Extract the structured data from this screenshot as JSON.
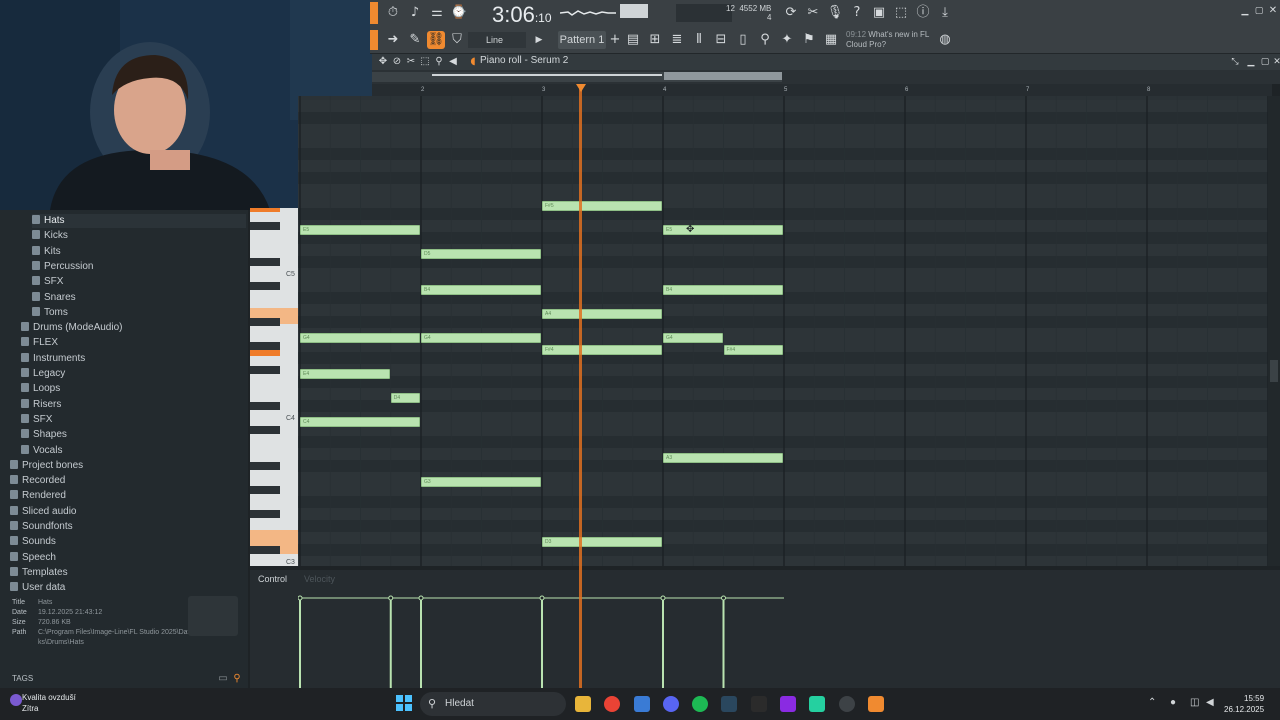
{
  "toolbar": {
    "time_main": "3:06",
    "time_sub": "10",
    "cpu_top": "12",
    "ram": "4552 MB",
    "cpu_bottom": "4",
    "mode": "Line",
    "pattern": "Pattern 1",
    "news_time": "09:12",
    "news_line1": "What's new in FL",
    "news_line2": "Cloud Pro?"
  },
  "piano_roll": {
    "title": "Piano roll - Serum 2",
    "bars": [
      "2",
      "3",
      "4",
      "5",
      "6",
      "7",
      "8"
    ],
    "octaves": [
      "C5",
      "C4",
      "C3"
    ],
    "notes": [
      {
        "label": "F#5",
        "start": 3.0,
        "len": 1.0,
        "row": 0
      },
      {
        "label": "E5",
        "start": 1.0,
        "len": 1.0,
        "row": 2
      },
      {
        "label": "E5",
        "start": 4.0,
        "len": 1.0,
        "row": 2
      },
      {
        "label": "D5",
        "start": 2.0,
        "len": 1.0,
        "row": 4
      },
      {
        "label": "B4",
        "start": 2.0,
        "len": 1.0,
        "row": 7
      },
      {
        "label": "B4",
        "start": 4.0,
        "len": 1.0,
        "row": 7
      },
      {
        "label": "A4",
        "start": 3.0,
        "len": 1.0,
        "row": 9
      },
      {
        "label": "G4",
        "start": 1.0,
        "len": 1.0,
        "row": 11
      },
      {
        "label": "G4",
        "start": 2.0,
        "len": 1.0,
        "row": 11
      },
      {
        "label": "G4",
        "start": 4.0,
        "len": 0.5,
        "row": 11
      },
      {
        "label": "F#4",
        "start": 3.0,
        "len": 1.0,
        "row": 12
      },
      {
        "label": "F#4",
        "start": 4.5,
        "len": 0.5,
        "row": 12
      },
      {
        "label": "E4",
        "start": 1.0,
        "len": 0.75,
        "row": 14
      },
      {
        "label": "D4",
        "start": 1.75,
        "len": 0.25,
        "row": 16
      },
      {
        "label": "C4",
        "start": 1.0,
        "len": 1.0,
        "row": 18
      },
      {
        "label": "A3",
        "start": 4.0,
        "len": 1.0,
        "row": 21
      },
      {
        "label": "G3",
        "start": 2.0,
        "len": 1.0,
        "row": 23
      },
      {
        "label": "D3",
        "start": 3.0,
        "len": 1.0,
        "row": 28
      }
    ],
    "control_label": "Control",
    "control_sub": "Velocity"
  },
  "browser": {
    "items": [
      {
        "label": "Hats",
        "indent": 2,
        "selected": true
      },
      {
        "label": "Kicks",
        "indent": 2
      },
      {
        "label": "Kits",
        "indent": 2
      },
      {
        "label": "Percussion",
        "indent": 2
      },
      {
        "label": "SFX",
        "indent": 2
      },
      {
        "label": "Snares",
        "indent": 2
      },
      {
        "label": "Toms",
        "indent": 2
      },
      {
        "label": "Drums (ModeAudio)",
        "indent": 1
      },
      {
        "label": "FLEX",
        "indent": 1
      },
      {
        "label": "Instruments",
        "indent": 1
      },
      {
        "label": "Legacy",
        "indent": 1
      },
      {
        "label": "Loops",
        "indent": 1
      },
      {
        "label": "Risers",
        "indent": 1
      },
      {
        "label": "SFX",
        "indent": 1
      },
      {
        "label": "Shapes",
        "indent": 1
      },
      {
        "label": "Vocals",
        "indent": 1
      },
      {
        "label": "Project bones",
        "indent": 0
      },
      {
        "label": "Recorded",
        "indent": 0
      },
      {
        "label": "Rendered",
        "indent": 0
      },
      {
        "label": "Sliced audio",
        "indent": 0
      },
      {
        "label": "Soundfonts",
        "indent": 0
      },
      {
        "label": "Sounds",
        "indent": 0
      },
      {
        "label": "Speech",
        "indent": 0
      },
      {
        "label": "Templates",
        "indent": 0
      },
      {
        "label": "User data",
        "indent": 0
      }
    ],
    "info": {
      "title_key": "Title",
      "title_val": "Hats",
      "date_key": "Date",
      "date_val": "19.12.2025 21:43:12",
      "size_key": "Size",
      "size_val": "720.86 KB",
      "path_key": "Path",
      "path_val": "C:\\Program Files\\Image-Line\\FL Studio 2025\\Data\\Patches\\Packs\\Drums\\Hats"
    },
    "tags_label": "TAGS"
  },
  "taskbar": {
    "weather_title": "Kvalita ovzduší",
    "weather_sub": "Zítra",
    "search_placeholder": "Hledat",
    "time": "15:59",
    "date": "26.12.2025"
  },
  "colors": {
    "note": "#b9e3b0",
    "playhead": "#e07020",
    "accent_key": "#f3b785"
  }
}
